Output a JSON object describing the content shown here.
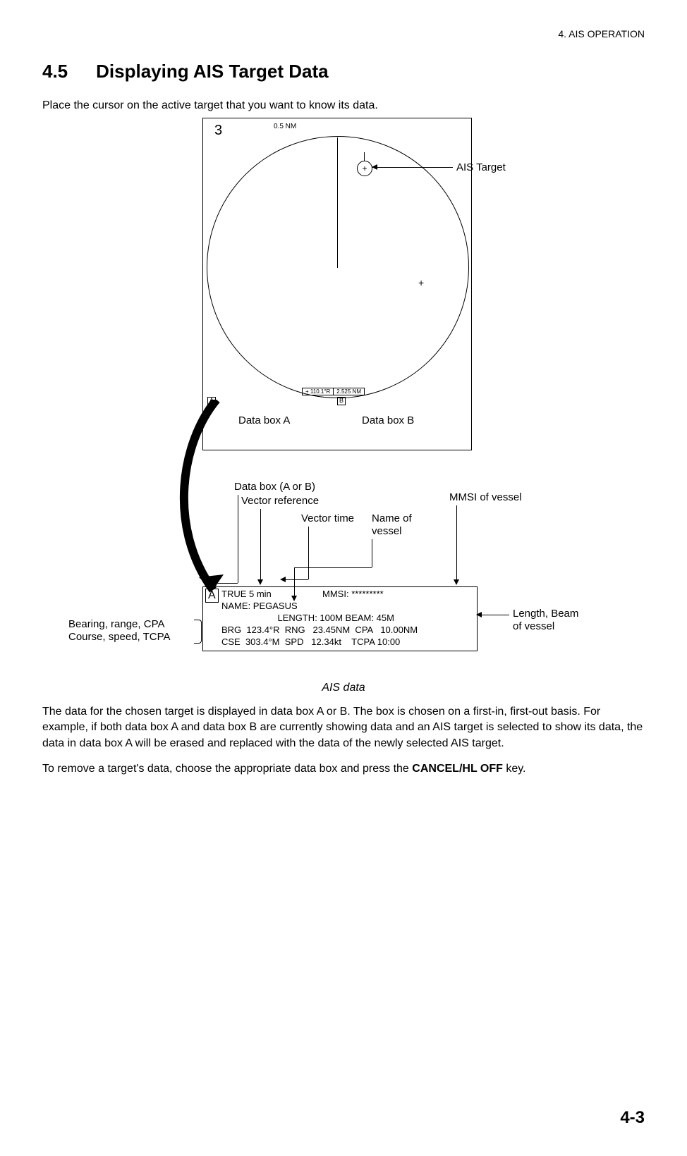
{
  "chapterHeader": "4. AIS OPERATION",
  "sectionNumber": "4.5",
  "sectionTitle": "Displaying AIS Target Data",
  "intro": "Place the cursor on the active target that you want to know its data.",
  "radar": {
    "rangeNum": "3",
    "rangeUnit": "0.5\nNM",
    "cursorBearing": "+ 110.1°R",
    "cursorRange": "2.525 NM",
    "boxLetterA": "A",
    "boxLetterB": "B",
    "boxLabelA": "Data box A",
    "boxLabelB": "Data box B",
    "targetPlus": "+",
    "ownPlus": "+"
  },
  "callouts": {
    "aisTarget": "AIS Target",
    "dataBoxAB": "Data box (A or B)",
    "vectorRef": "Vector reference",
    "vectorTime": "Vector time",
    "nameOfVessel": "Name of\nvessel",
    "mmsi": "MMSI of vessel",
    "bearingLeft": "Bearing, range, CPA\nCourse, speed, TCPA",
    "lengthBeam": "Length, Beam\nof vessel"
  },
  "databox": {
    "letter": "A",
    "line1": "TRUE 5 min                    MMSI: *********",
    "line2": "NAME: PEGASUS",
    "line3": "                      LENGTH: 100M BEAM: 45M",
    "line4": "BRG  123.4°R  RNG   23.45NM  CPA   10.00NM",
    "line5": "CSE  303.4°M  SPD   12.34kt    TCPA 10:00"
  },
  "figCaption": "AIS data",
  "para1": "The data for the chosen target is displayed in data box A or B. The box is chosen on a first-in, first-out basis. For example, if both data box A and data box B are currently showing data and an AIS target is selected to show its data, the data in data box A will be erased and replaced with the data of the newly selected AIS target.",
  "para2a": "To remove a target's data, choose the appropriate data box and press the ",
  "para2b": "CANCEL/HL OFF",
  "para2c": " key.",
  "pageNum": "4-3"
}
